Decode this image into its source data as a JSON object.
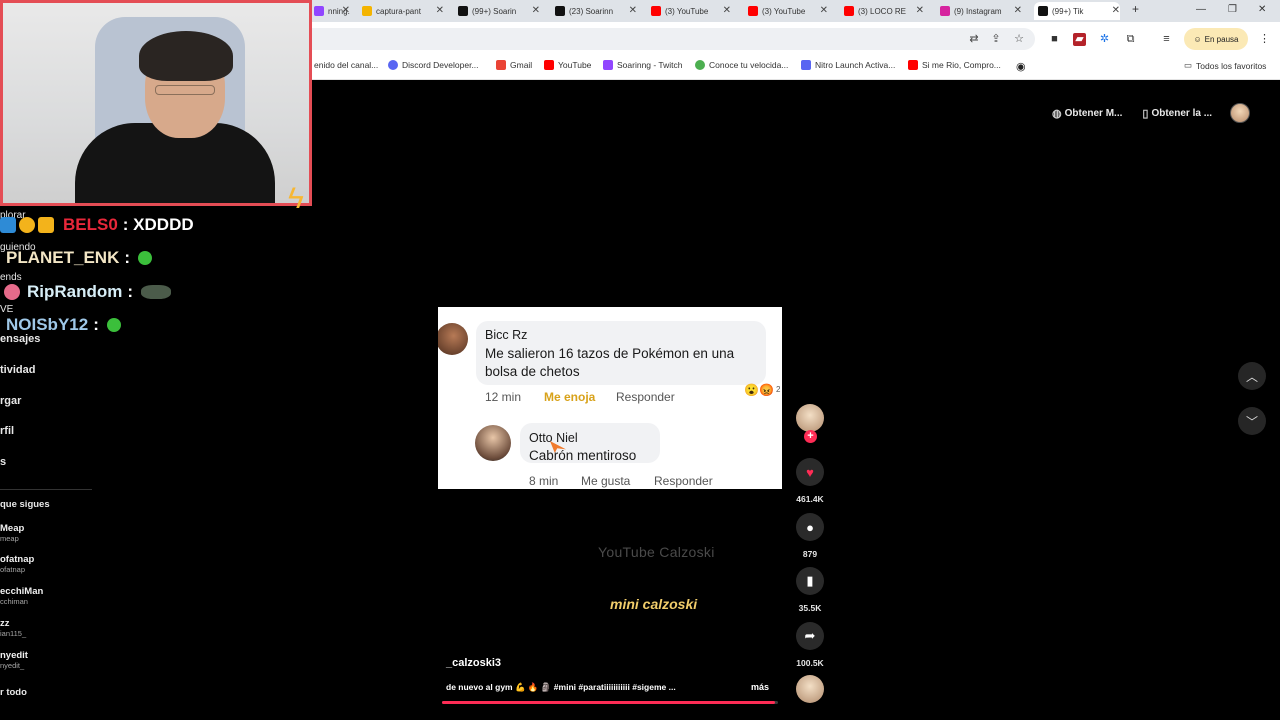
{
  "browser": {
    "tabs": [
      {
        "label": "nning...",
        "color": "#9146ff"
      },
      {
        "label": "captura-pant",
        "color": "#f4b400"
      },
      {
        "label": "(99+) Soarin",
        "color": "#111111"
      },
      {
        "label": "(23) Soarinn",
        "color": "#111111"
      },
      {
        "label": "(3) YouTube",
        "color": "#ff0000"
      },
      {
        "label": "(3) YouTube",
        "color": "#ff0000"
      },
      {
        "label": "(3) LOCO RE",
        "color": "#ff0000"
      },
      {
        "label": "(9) Instagram",
        "color": "#d6249f"
      },
      {
        "label": "(99+) Tik",
        "color": "#111111"
      }
    ],
    "new_tab": "+",
    "pause_label": "En pausa",
    "bookmarks": [
      {
        "label": "enido del canal...",
        "color": "#ff0000"
      },
      {
        "label": "Discord Developer...",
        "color": "#5865f2"
      },
      {
        "label": "Gmail",
        "color": "#ea4335"
      },
      {
        "label": "YouTube",
        "color": "#ff0000"
      },
      {
        "label": "Soarinng - Twitch",
        "color": "#9146ff"
      },
      {
        "label": "Conoce tu velocida...",
        "color": "#4caf50"
      },
      {
        "label": "Nitro Launch Activa...",
        "color": "#5865f2"
      },
      {
        "label": "Si me Rio, Compro...",
        "color": "#ff0000"
      }
    ],
    "all_bookmarks": "Todos los favoritos"
  },
  "tiktok_header": {
    "get_app_1": "Obtener M...",
    "get_app_2": "Obtener la ..."
  },
  "stream_chat": [
    {
      "user": "BELS0",
      "message": ": XDDDD",
      "color": "#e8273a"
    },
    {
      "user": "PLANET_ENK",
      "message": ":",
      "color": "#f3e6c5"
    },
    {
      "user": "RipRandom",
      "message": ":",
      "color": "#d7eef7"
    },
    {
      "user": "NOISbY12",
      "message": ":",
      "color": "#9fc8e8"
    }
  ],
  "twitch_sidebar": {
    "small_labels": [
      "plorar",
      "guiendo",
      "ends",
      "VE"
    ],
    "items": [
      "ensajes",
      "tividad",
      "rgar",
      "rfil",
      "s"
    ],
    "following_header": "que sigues",
    "channels": [
      {
        "name": "Meap",
        "handle": "meap"
      },
      {
        "name": "ofatnap",
        "handle": "ofatnap"
      },
      {
        "name": "ecchiMan",
        "handle": "cchiman"
      },
      {
        "name": "zz",
        "handle": "ian115_"
      },
      {
        "name": "nyedit",
        "handle": "nyedit_"
      }
    ],
    "show_all": "r todo"
  },
  "video": {
    "comment_1": {
      "name": "Bicc Rz",
      "text_line_1": "Me salieron 16 tazos de Pokémon en una",
      "text_line_2": "bolsa de chetos",
      "time": "12 min",
      "reaction": "Me enoja",
      "reply": "Responder",
      "reaction_count": "2"
    },
    "comment_2": {
      "name": "Otto Niel",
      "text": "Cabrón mentiroso",
      "time": "8 min",
      "reaction": "Me gusta",
      "reply": "Responder"
    },
    "watermark": "YouTube Calzoski",
    "title_overlay": "mini calzoski",
    "author": "_calzoski3",
    "caption": "de nuevo al gym 💪 🔥 🗿 #mini #paratiiiiiiiiiii #sigeme ...",
    "more": "más",
    "progress": 0.99
  },
  "actions": {
    "likes": "461.4K",
    "comments": "879",
    "saves": "35.5K",
    "shares": "100.5K"
  },
  "colors": {
    "accent": "#fe2c55",
    "webcam_border": "#e44d55"
  }
}
